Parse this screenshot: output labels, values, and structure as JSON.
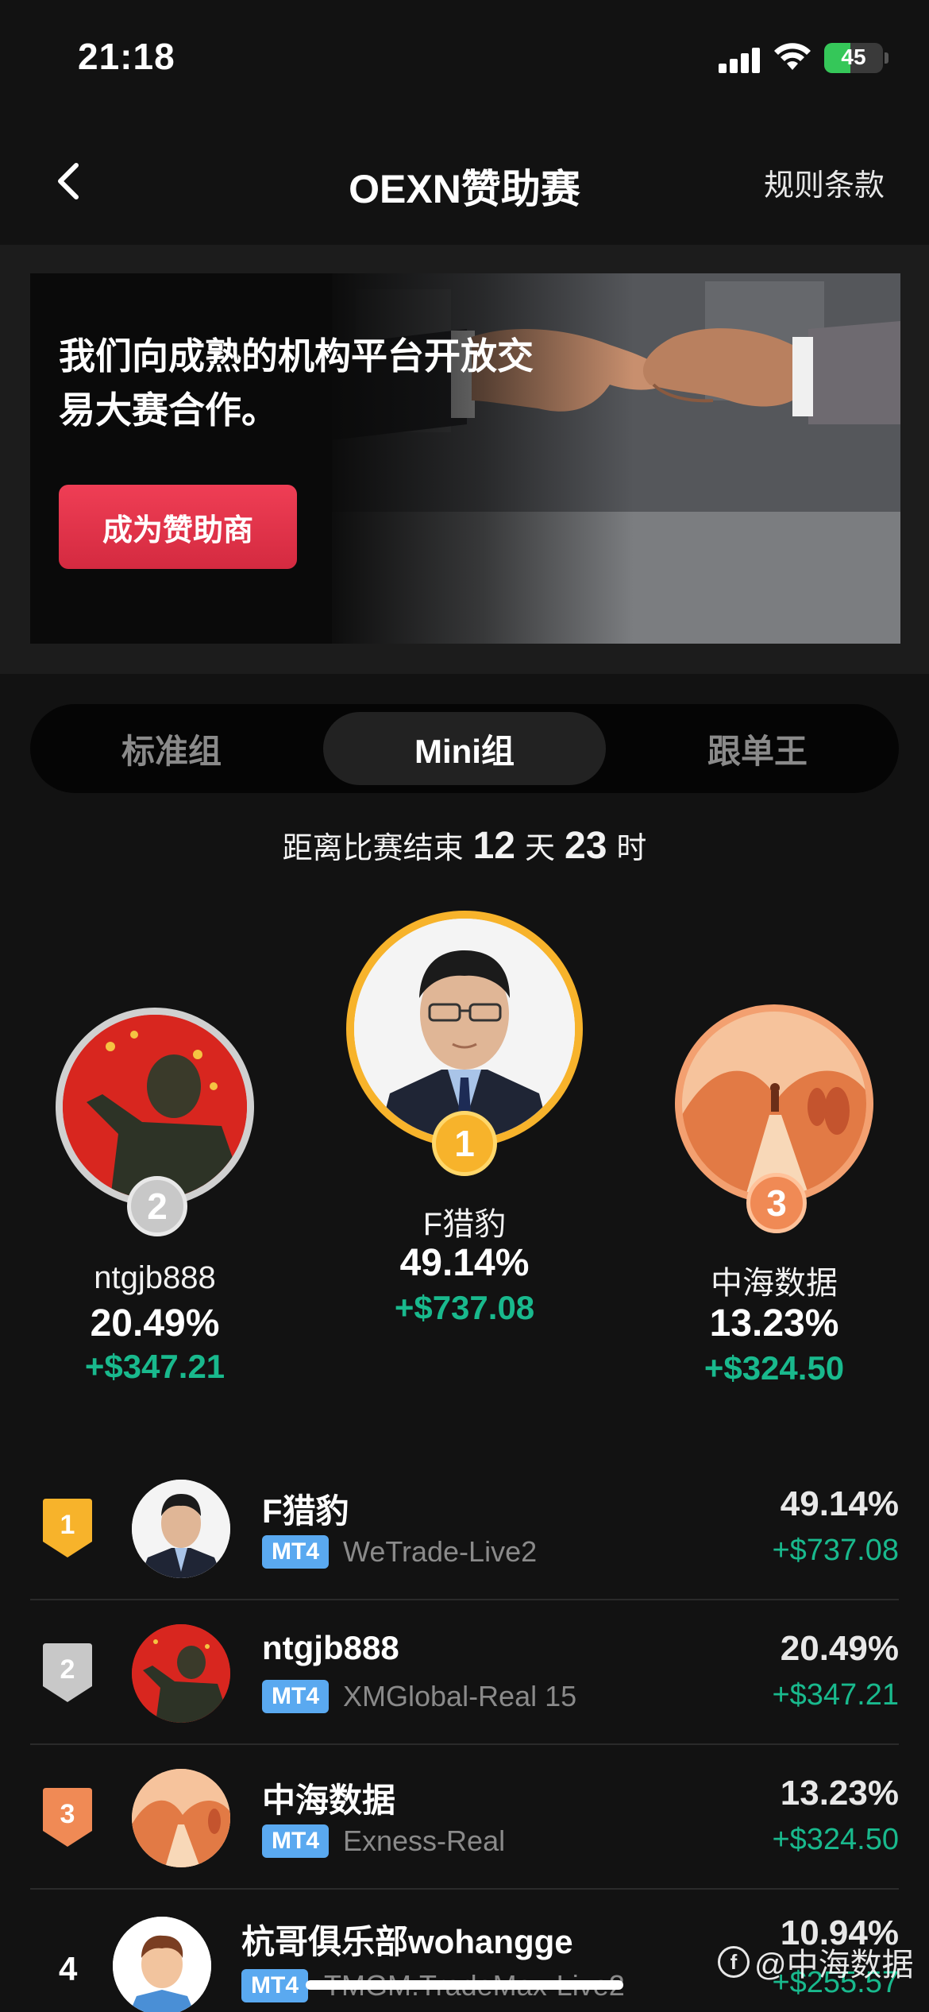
{
  "status_bar": {
    "time": "21:18",
    "battery": "45",
    "battery_level": 0.45
  },
  "nav": {
    "title": "OEXN赞助赛",
    "right_link": "规则条款"
  },
  "banner": {
    "headline": "我们向成熟的机构平台开放交易大赛合作。",
    "cta": "成为赞助商"
  },
  "tabs": [
    {
      "label": "标准组",
      "active": false
    },
    {
      "label": "Mini组",
      "active": true
    },
    {
      "label": "跟单王",
      "active": false
    }
  ],
  "countdown": {
    "prefix": "距离比赛结束",
    "days": "12",
    "days_unit": "天",
    "hours": "23",
    "hours_unit": "时"
  },
  "podium": {
    "first": {
      "rank": "1",
      "name": "F猎豹",
      "pct": "49.14%",
      "amount": "+$737.08"
    },
    "second": {
      "rank": "2",
      "name": "ntgjb888",
      "pct": "20.49%",
      "amount": "+$347.21"
    },
    "third": {
      "rank": "3",
      "name": "中海数据",
      "pct": "13.23%",
      "amount": "+$324.50"
    }
  },
  "leaderboard": [
    {
      "rank": "1",
      "name": "F猎豹",
      "platform": "MT4",
      "server": "WeTrade-Live2",
      "pct": "49.14%",
      "amount": "+$737.08"
    },
    {
      "rank": "2",
      "name": "ntgjb888",
      "platform": "MT4",
      "server": "XMGlobal-Real 15",
      "pct": "20.49%",
      "amount": "+$347.21"
    },
    {
      "rank": "3",
      "name": "中海数据",
      "platform": "MT4",
      "server": "Exness-Real",
      "pct": "13.23%",
      "amount": "+$324.50"
    },
    {
      "rank": "4",
      "name": "杭哥俱乐部wohangge",
      "platform": "MT4",
      "server": "TMGM.TradeMax-Live2",
      "pct": "10.94%",
      "amount": "+$255.57"
    }
  ],
  "watermark": "@中海数据",
  "colors": {
    "gain": "#19b98d",
    "cta": "#e0344b",
    "gold": "#f7b32b",
    "silver": "#c8c8c8",
    "bronze": "#f08a55",
    "mt4": "#5aa9f0"
  }
}
